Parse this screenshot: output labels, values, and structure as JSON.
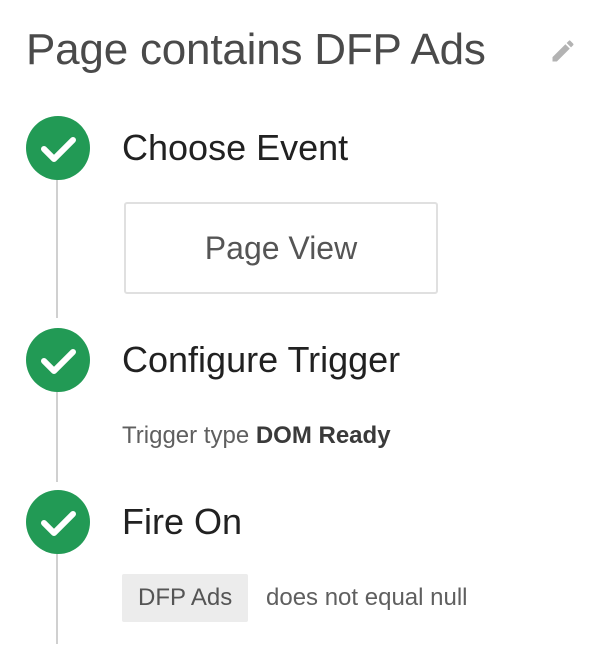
{
  "header": {
    "title": "Page contains DFP Ads",
    "edit_icon": "pencil-icon"
  },
  "colors": {
    "check_green": "#229a55",
    "timeline_gray": "#d0d0d0",
    "chip_bg": "#ececec"
  },
  "steps": [
    {
      "title": "Choose Event",
      "status_icon": "check-icon",
      "event_value": "Page View"
    },
    {
      "title": "Configure Trigger",
      "status_icon": "check-icon",
      "trigger_type_label": "Trigger type",
      "trigger_type_value": "DOM Ready"
    },
    {
      "title": "Fire On",
      "status_icon": "check-icon",
      "condition": {
        "variable": "DFP Ads",
        "operator_text": "does not equal null"
      }
    }
  ]
}
